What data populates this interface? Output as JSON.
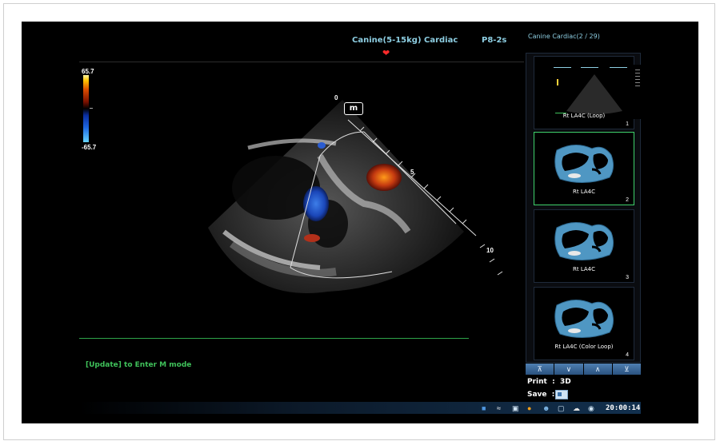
{
  "header": {
    "title": "Canine(5-15kg) Cardiac",
    "probe": "P8-2s",
    "exam": "Canine Cardiac(2 / 29)"
  },
  "color_scale": {
    "max": "65.7",
    "min": "-65.7"
  },
  "image": {
    "mode_badge": "m",
    "depth_labels": [
      "0",
      "5",
      "10"
    ]
  },
  "prompt": "[Update] to Enter M mode",
  "thumbnails": [
    {
      "label": "Rt LA4C (Loop)",
      "index": "1",
      "selected": false
    },
    {
      "label": "Rt LA4C",
      "index": "2",
      "selected": true
    },
    {
      "label": "Rt LA4C",
      "index": "3",
      "selected": false
    },
    {
      "label": "Rt LA4C (Color Loop)",
      "index": "4",
      "selected": false
    }
  ],
  "nav_buttons": [
    "first-page-icon",
    "page-down-icon",
    "page-up-icon",
    "last-page-icon"
  ],
  "print": {
    "label": "Print",
    "value": "3D"
  },
  "save": {
    "label": "Save"
  },
  "status": {
    "icons": [
      "probe-icon",
      "wifi-icon",
      "network-icon",
      "warning-icon",
      "user-icon",
      "monitor-icon",
      "print-queue-icon",
      "disk-icon"
    ],
    "time": "20:00:14"
  },
  "colors": {
    "accent": "#8ecfe3",
    "prompt": "#3fc15a",
    "selected_border": "#3fd16b",
    "heart": "#ff2a2a",
    "warning": "#f5a01a"
  }
}
